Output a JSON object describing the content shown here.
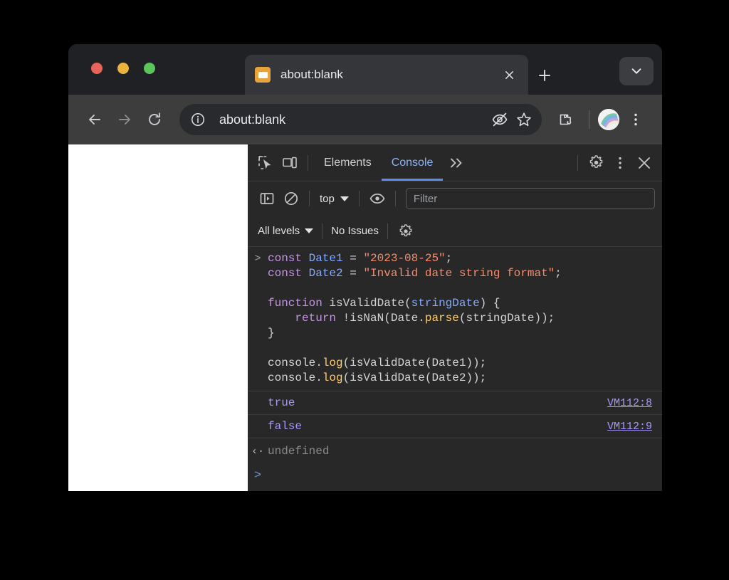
{
  "browser": {
    "window_controls": [
      "close",
      "minimize",
      "zoom"
    ],
    "tab": {
      "title": "about:blank",
      "favicon_name": "blank-page-favicon",
      "favicon_color": "#e8a33d",
      "close_label": "✕"
    },
    "new_tab_label": "+",
    "tab_search_label": "⌄",
    "nav": {
      "back_label": "←",
      "forward_label": "→",
      "reload_label": "↻",
      "url": "about:blank",
      "site_info_label": "i",
      "hide_label": "hide-password-icon",
      "bookmark_label": "☆",
      "extensions_label": "extensions-icon",
      "menu_label": "⋮"
    }
  },
  "devtools": {
    "toolbar": {
      "inspect_label": "inspect-element-icon",
      "device_label": "device-toolbar-icon",
      "tabs": [
        {
          "label": "Elements",
          "active": false
        },
        {
          "label": "Console",
          "active": true
        }
      ],
      "more_panels_label": "»",
      "settings_label": "gear-icon",
      "kebab_label": "⋮",
      "close_label": "✕"
    },
    "console_toolbar": {
      "sidebar_label": "console-sidebar-icon",
      "clear_label": "clear-console-icon",
      "context": "top",
      "eye_label": "live-expression-icon",
      "filter_placeholder": "Filter",
      "filter_value": ""
    },
    "levels_bar": {
      "levels": "All levels",
      "issues": "No Issues",
      "settings_label": "gear-icon"
    },
    "console": {
      "prompt_glyph": ">",
      "result_glyph": "‹·",
      "input_lines": [
        [
          {
            "t": "const ",
            "c": "kw"
          },
          {
            "t": "Date1",
            "c": "var"
          },
          {
            "t": " = ",
            "c": "plain"
          },
          {
            "t": "\"2023-08-25\"",
            "c": "str"
          },
          {
            "t": ";",
            "c": "plain"
          }
        ],
        [
          {
            "t": "const ",
            "c": "kw"
          },
          {
            "t": "Date2",
            "c": "var"
          },
          {
            "t": " = ",
            "c": "plain"
          },
          {
            "t": "\"Invalid date string format\"",
            "c": "str"
          },
          {
            "t": ";",
            "c": "plain"
          }
        ],
        [],
        [
          {
            "t": "function ",
            "c": "kw"
          },
          {
            "t": "isValidDate",
            "c": "plain"
          },
          {
            "t": "(",
            "c": "plain"
          },
          {
            "t": "stringDate",
            "c": "var"
          },
          {
            "t": ") {",
            "c": "plain"
          }
        ],
        [
          {
            "t": "    ",
            "c": "plain"
          },
          {
            "t": "return ",
            "c": "kw"
          },
          {
            "t": "!isNaN(Date.",
            "c": "plain"
          },
          {
            "t": "parse",
            "c": "fn"
          },
          {
            "t": "(stringDate));",
            "c": "plain"
          }
        ],
        [
          {
            "t": "}",
            "c": "plain"
          }
        ],
        [],
        [
          {
            "t": "console.",
            "c": "plain"
          },
          {
            "t": "log",
            "c": "fn"
          },
          {
            "t": "(isValidDate(Date1));",
            "c": "plain"
          }
        ],
        [
          {
            "t": "console.",
            "c": "plain"
          },
          {
            "t": "log",
            "c": "fn"
          },
          {
            "t": "(isValidDate(Date2));",
            "c": "plain"
          }
        ]
      ],
      "messages": [
        {
          "value": "true",
          "source": "VM112:8"
        },
        {
          "value": "false",
          "source": "VM112:9"
        }
      ],
      "result": "undefined"
    }
  }
}
